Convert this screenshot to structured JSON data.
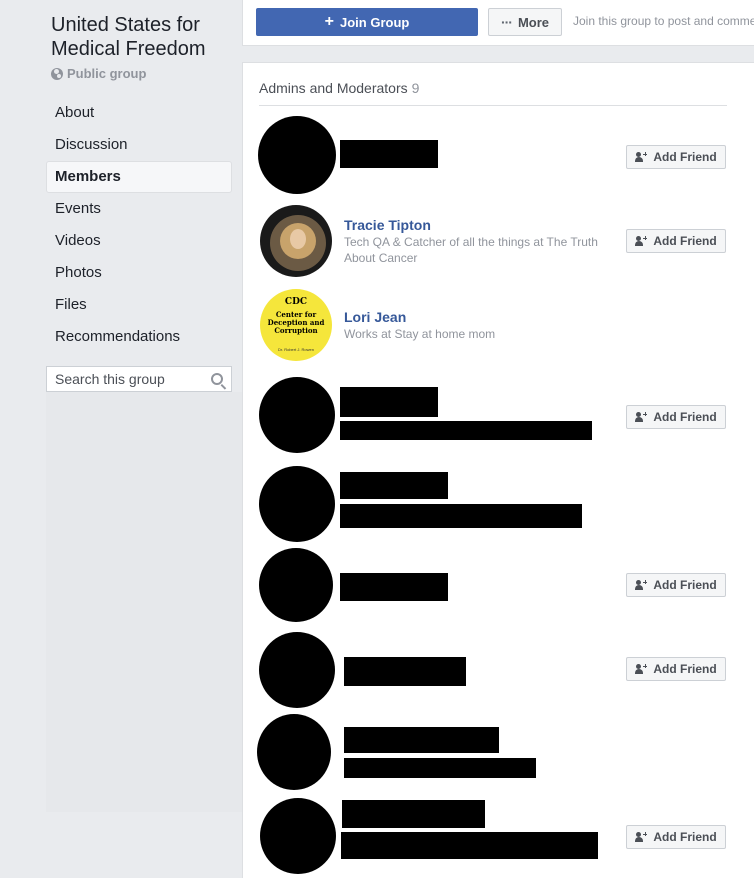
{
  "group": {
    "name": "United States for Medical Freedom",
    "privacy": "Public group"
  },
  "nav": {
    "items": [
      {
        "label": "About"
      },
      {
        "label": "Discussion"
      },
      {
        "label": "Members",
        "active": true
      },
      {
        "label": "Events"
      },
      {
        "label": "Videos"
      },
      {
        "label": "Photos"
      },
      {
        "label": "Files"
      },
      {
        "label": "Recommendations"
      }
    ]
  },
  "search": {
    "placeholder": "Search this group"
  },
  "topbar": {
    "join_label": "Join Group",
    "more_label": "More",
    "hint": "Join this group to post and comment."
  },
  "admins": {
    "heading": "Admins and Moderators",
    "count": "9",
    "add_friend_label": "Add Friend",
    "members": [
      {
        "name": "",
        "redacted": true,
        "has_add_friend": true
      },
      {
        "name": "Tracie Tipton",
        "info": "Tech QA & Catcher of all the things at The Truth About Cancer",
        "has_add_friend": true
      },
      {
        "name": "Lori Jean",
        "info": "Works at Stay at home mom",
        "has_add_friend": false,
        "avatar_text": "CDC",
        "avatar_subtext": "Center for Deception and Corruption",
        "avatar_byline": "Dr. Robert J. Rowen"
      },
      {
        "name": "",
        "redacted": true,
        "has_add_friend": true
      },
      {
        "name": "",
        "redacted": true,
        "has_add_friend": false
      },
      {
        "name": "",
        "redacted": true,
        "has_add_friend": true
      },
      {
        "name": "",
        "redacted": true,
        "has_add_friend": true
      },
      {
        "name": "",
        "redacted": true,
        "has_add_friend": false
      },
      {
        "name": "",
        "redacted": true,
        "has_add_friend": true
      }
    ]
  },
  "colors": {
    "brand": "#4267b2",
    "link": "#365899",
    "page_bg": "#e9ebee"
  }
}
